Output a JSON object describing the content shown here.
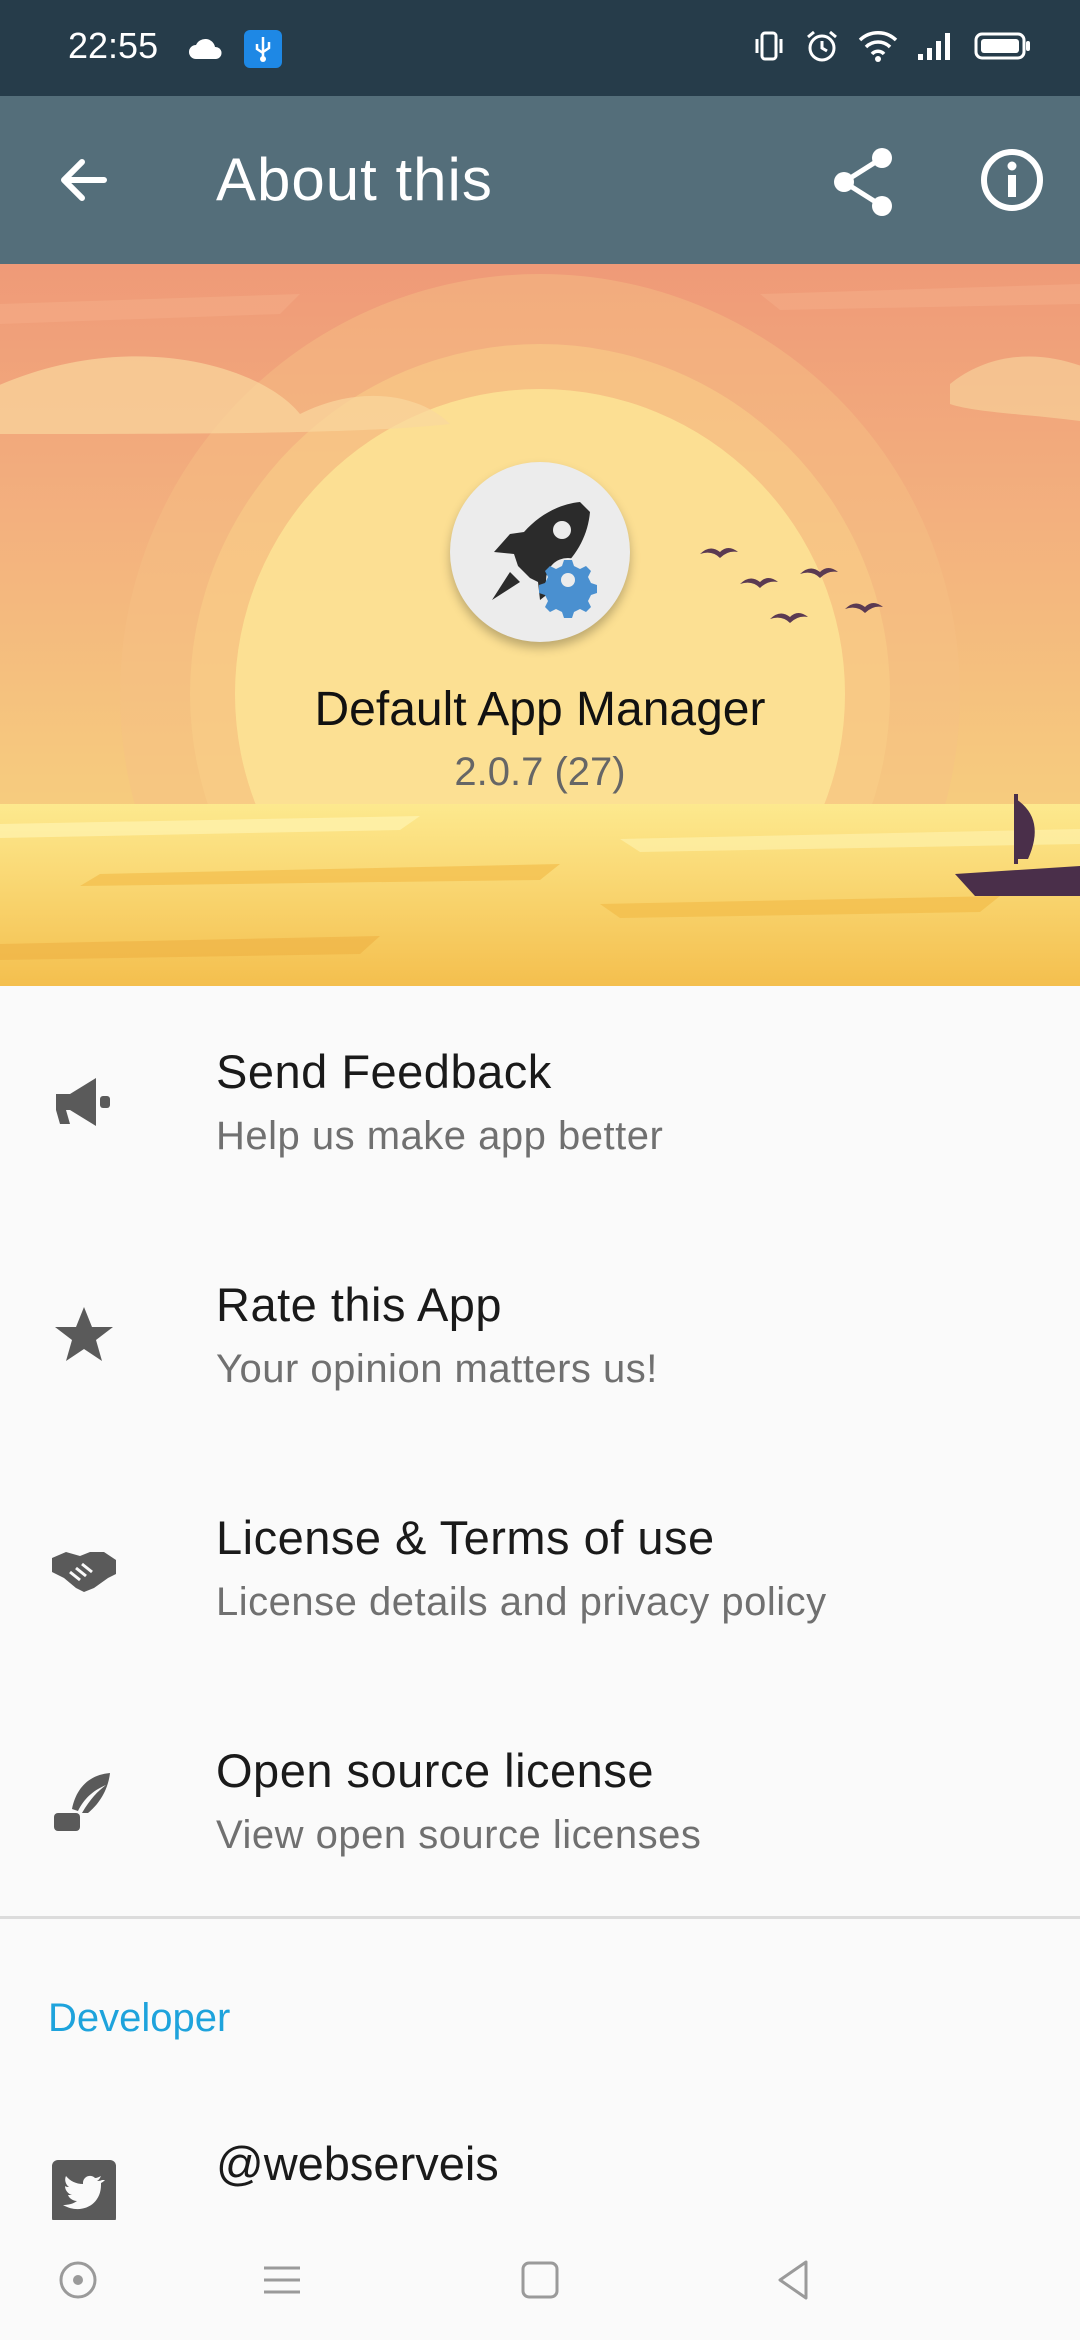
{
  "status_bar": {
    "time": "22:55",
    "icons_left": [
      "cloud-icon",
      "usb-icon"
    ],
    "icons_right": [
      "vibrate-icon",
      "alarm-icon",
      "wifi-icon",
      "signal-icon",
      "battery-icon"
    ]
  },
  "app_bar": {
    "title": "About this",
    "background": "#546e7a",
    "actions": [
      "back-arrow-icon",
      "share-icon",
      "info-icon"
    ]
  },
  "hero": {
    "app_name": "Default App Manager",
    "version": "2.0.7 (27)"
  },
  "menu": [
    {
      "icon": "megaphone-icon",
      "title": "Send Feedback",
      "subtitle": "Help us make app better"
    },
    {
      "icon": "star-icon",
      "title": "Rate this App",
      "subtitle": "Your opinion matters us!"
    },
    {
      "icon": "handshake-icon",
      "title": "License & Terms of use",
      "subtitle": "License details and privacy policy"
    },
    {
      "icon": "quill-icon",
      "title": "Open source license",
      "subtitle": "View open source licenses"
    }
  ],
  "developer": {
    "section_title": "Developer",
    "accent": "#1ea3dc",
    "twitter": "@webserveis"
  },
  "nav_bar": [
    "assistant-button",
    "menu-button",
    "home-button",
    "back-button"
  ]
}
